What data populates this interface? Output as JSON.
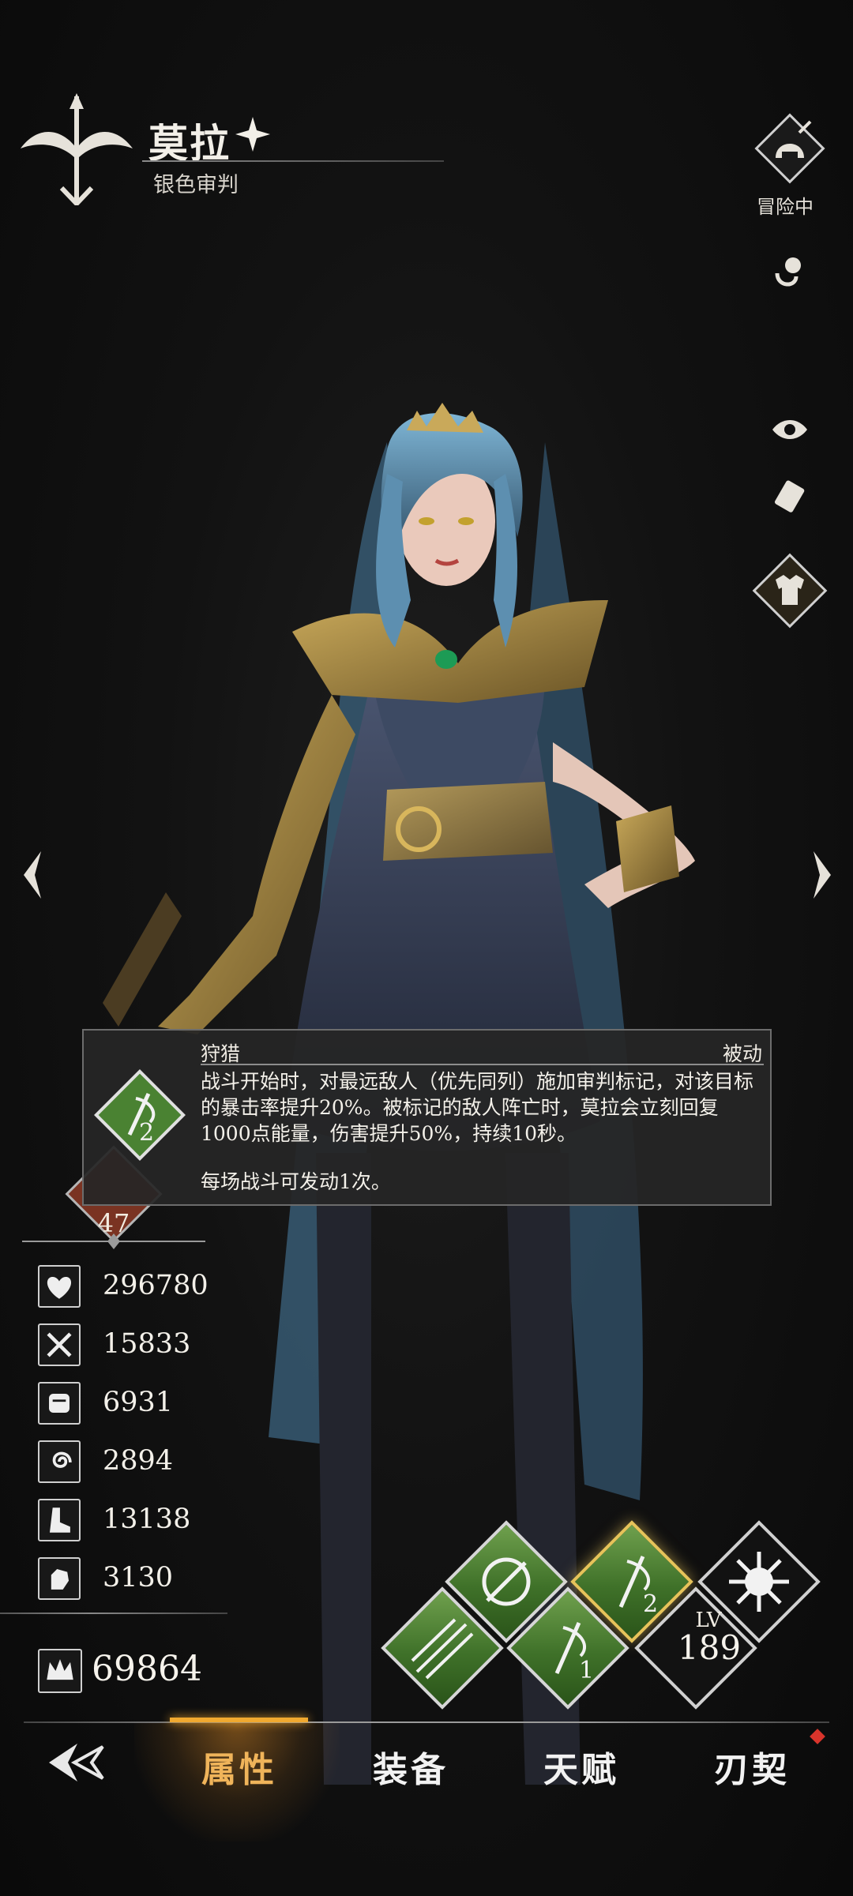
{
  "hero": {
    "name": "莫拉",
    "title": "银色审判"
  },
  "status": {
    "adventure_label": "冒险中"
  },
  "tooltip": {
    "skill_name": "狩猎",
    "skill_type": "被动",
    "description": "战斗开始时，对最远敌人（优先同列）施加审判标记，对该目标的暴击率提升20%。被标记的敌人阵亡时，莫拉会立刻回复1000点能量，伤害提升50%，持续10秒。",
    "note": "每场战斗可发动1次。",
    "icon_number": "2"
  },
  "badge_level": "47",
  "stats": [
    {
      "icon": "heart-icon",
      "value": "296780"
    },
    {
      "icon": "crossed-swords-icon",
      "value": "15833"
    },
    {
      "icon": "fist-icon",
      "value": "6931"
    },
    {
      "icon": "swirl-icon",
      "value": "2894"
    },
    {
      "icon": "boot-icon",
      "value": "13138"
    },
    {
      "icon": "grab-hand-icon",
      "value": "3130"
    }
  ],
  "power": "69864",
  "skills": {
    "s1_number": "1",
    "s2_number": "2",
    "lv_label": "LV",
    "level": "189"
  },
  "nav": {
    "tabs": [
      "属性",
      "装备",
      "天赋",
      "刃契"
    ],
    "active_index": 0
  },
  "colors": {
    "accent": "#f0a930",
    "skill_green": "#4f8a33",
    "notification": "#d9342b"
  }
}
